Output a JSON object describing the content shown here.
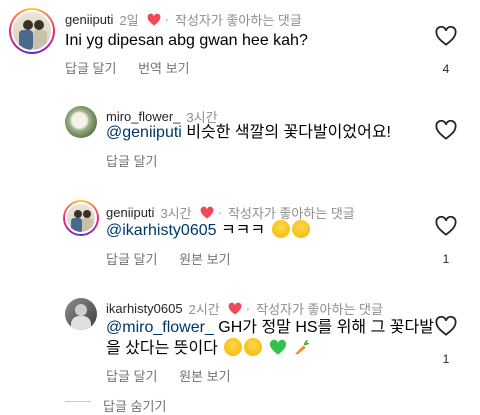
{
  "comments": [
    {
      "username": "geniiputi",
      "time": "2일",
      "author_liked_label": "작성자가 좋아하는 댓글",
      "mention": "",
      "text": "Ini yg dipesan abg gwan hee kah?",
      "actions": [
        "답글 달기",
        "번역 보기"
      ],
      "like_count": "4"
    },
    {
      "username": "miro_flower_",
      "time": "3시간",
      "author_liked_label": "",
      "mention": "@geniiputi",
      "text": " 비슷한 색깔의 꽃다발이었어요!",
      "actions": [
        "답글 달기"
      ],
      "like_count": ""
    },
    {
      "username": "geniiputi",
      "time": "3시간",
      "author_liked_label": "작성자가 좋아하는 댓글",
      "mention": "@ikarhisty0605",
      "text": " ㅋㅋㅋ",
      "actions": [
        "답글 달기",
        "원본 보기"
      ],
      "like_count": "1"
    },
    {
      "username": "ikarhisty0605",
      "time": "2시간",
      "author_liked_label": "작성자가 좋아하는 댓글",
      "mention": "@miro_flower_",
      "text": " GH가 정말 HS를 위해 그 꽃다발",
      "text_line2": "을 샀다는 뜻이다",
      "actions": [
        "답글 달기",
        "원본 보기"
      ],
      "like_count": "1"
    }
  ],
  "hide_replies": "답글 숨기기",
  "icons": {
    "heart": "heart-outline-icon",
    "author_liked": "red-heart-icon"
  },
  "colors": {
    "mention": "#00376b",
    "author_heart": "#ed4956",
    "secondary_text": "#737373"
  }
}
